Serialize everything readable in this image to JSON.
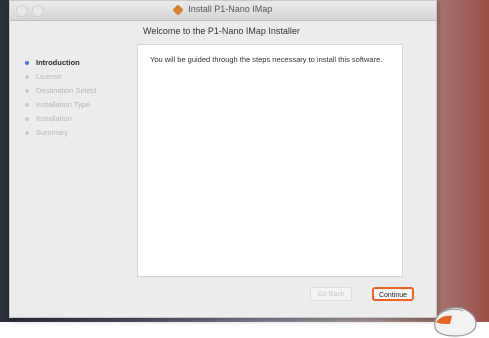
{
  "window": {
    "title": "Install P1-Nano IMap"
  },
  "header": {
    "title": "Welcome to the P1-Nano IMap Installer"
  },
  "sidebar": {
    "items": [
      {
        "label": "Introduction",
        "active": true
      },
      {
        "label": "License",
        "active": false
      },
      {
        "label": "Destination Select",
        "active": false
      },
      {
        "label": "Installation Type",
        "active": false
      },
      {
        "label": "Installation",
        "active": false
      },
      {
        "label": "Summary",
        "active": false
      }
    ]
  },
  "content": {
    "text": "You will be guided through the steps necessary to install this software."
  },
  "buttons": {
    "back_label": "Go Back",
    "continue_label": "Continue"
  },
  "colors": {
    "accent_highlight": "#e8641f",
    "active_bullet": "#3e7be0"
  },
  "icons": {
    "title_icon": "package-icon",
    "cursor": "mouse-illustration-icon"
  }
}
